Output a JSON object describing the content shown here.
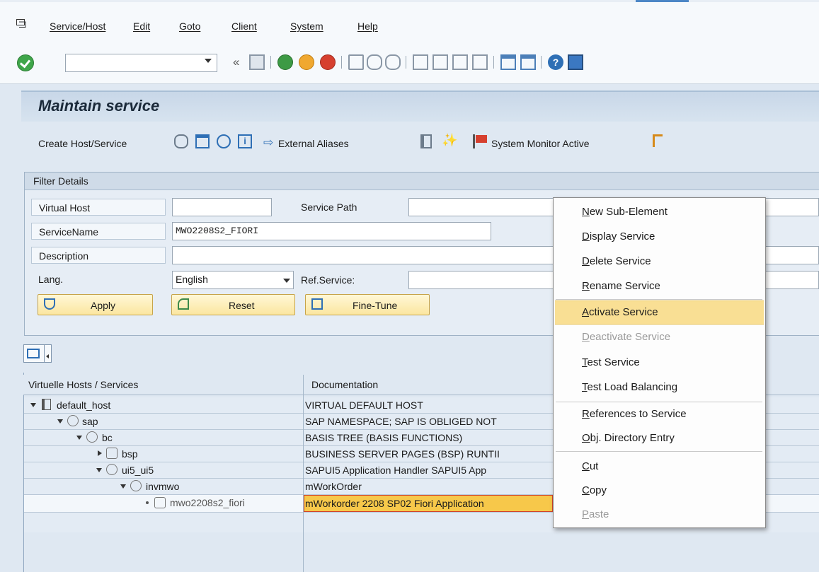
{
  "menu": {
    "items": [
      "Service/Host",
      "Edit",
      "Goto",
      "Client",
      "System",
      "Help"
    ]
  },
  "toolbar": {
    "command_field_value": "",
    "icons": [
      "check-icon",
      "save-icon",
      "back-icon",
      "exit-icon",
      "cancel-icon",
      "print-icon",
      "find-icon",
      "find-next-icon",
      "first-page-icon",
      "previous-page-icon",
      "next-page-icon",
      "last-page-icon",
      "create-session-icon",
      "shortcut-icon",
      "help-icon",
      "customize-layout-icon"
    ]
  },
  "page": {
    "title": "Maintain service"
  },
  "app_toolbar": {
    "create_label": "Create Host/Service",
    "external_aliases_label": "External Aliases",
    "system_monitor_label": "System Monitor Active"
  },
  "filter": {
    "title": "Filter Details",
    "virtual_host_label": "Virtual Host",
    "virtual_host_value": "",
    "service_path_label": "Service Path",
    "service_path_value": "",
    "service_name_label": "ServiceName",
    "service_name_value": "MWO2208S2_FIORI",
    "description_label": "Description",
    "description_value": "",
    "lang_label": "Lang.",
    "lang_value": "English",
    "ref_service_label": "Ref.Service:",
    "ref_service_value": "",
    "apply_label": "Apply",
    "reset_label": "Reset",
    "finetune_label": "Fine-Tune"
  },
  "tree": {
    "col1": "Virtuelle Hosts / Services",
    "col2": "Documentation",
    "rows": [
      {
        "name": "default_host",
        "doc": "VIRTUAL DEFAULT HOST"
      },
      {
        "name": "sap",
        "doc": "SAP NAMESPACE; SAP IS OBLIGED NOT"
      },
      {
        "name": "bc",
        "doc": "BASIS TREE (BASIS FUNCTIONS)"
      },
      {
        "name": "bsp",
        "doc": "BUSINESS SERVER PAGES (BSP) RUNTII"
      },
      {
        "name": "ui5_ui5",
        "doc": "SAPUI5 Application Handler SAPUI5 App"
      },
      {
        "name": "invmwo",
        "doc": "mWorkOrder"
      },
      {
        "name": "mwo2208s2_fiori",
        "doc": "mWorkorder 2208 SP02 Fiori Application"
      }
    ]
  },
  "context_menu": {
    "items": [
      {
        "u": "N",
        "rest": "ew Sub-Element"
      },
      {
        "u": "D",
        "rest": "isplay Service"
      },
      {
        "u": "D",
        "rest": "elete Service"
      },
      {
        "u": "R",
        "rest": "ename Service"
      },
      {
        "u": "A",
        "rest": "ctivate Service"
      },
      {
        "u": "D",
        "rest": "eactivate Service"
      },
      {
        "u": "T",
        "rest": "est Service"
      },
      {
        "u": "T",
        "rest": "est Load Balancing"
      },
      {
        "u": "R",
        "rest": "eferences to Service"
      },
      {
        "u": "O",
        "rest": "bj. Directory Entry"
      },
      {
        "u": "C",
        "rest": "ut"
      },
      {
        "u": "C",
        "rest": "opy"
      },
      {
        "u": "P",
        "rest": "aste"
      }
    ]
  },
  "colors": {
    "highlight": "#f9df94",
    "selected_cell": "#f7c84a",
    "accent": "#4c86c6"
  }
}
